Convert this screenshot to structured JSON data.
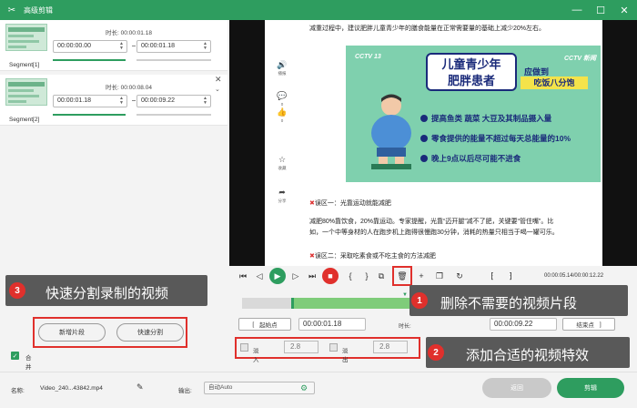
{
  "window": {
    "title": "高级剪辑"
  },
  "segments": [
    {
      "name": "Segment[1]",
      "duration_label": "时长:",
      "duration": "00:00:01.18",
      "start": "00:00:00.00",
      "end": "00:00:01.18"
    },
    {
      "name": "Segment[2]",
      "duration_label": "时长:",
      "duration": "00:00:08.04",
      "start": "00:00:01.18",
      "end": "00:00:09.22"
    }
  ],
  "annotations": {
    "n1": "1",
    "t1": "删除不需要的视频片段",
    "n2": "2",
    "t2": "添加合适的视频特效",
    "n3": "3",
    "t3": "快速分割录制的视频"
  },
  "left_buttons": {
    "new_segment": "新增片段",
    "quick_split": "快速分割"
  },
  "merge_all": "合并所有",
  "preview": {
    "text_top": "减重过程中，建议肥胖儿童青少年的膳食能量在正常需要量的基础上减少20%左右。",
    "banner": {
      "brand_left": "CCTV 13",
      "brand_right": "CCTV 新闻",
      "headline1": "儿童青少年",
      "headline2": "肥胖患者",
      "should": "应做到",
      "eat": "吃饭八分饱",
      "b1": "提高鱼类  蔬菜  大豆及其制品摄入量",
      "b2": "零食提供的能量不超过每天总能量的10%",
      "b3": "晚上9点以后尽可能不进食"
    },
    "mis1_title": "误区一：光靠运动就能减肥",
    "mis1_text1": "减肥80%靠饮食，20%靠运动。专家提醒，光靠“迈开腿”减不了肥，关键要“管住嘴”。比",
    "mis1_text2": "如，一个中等身材的人在跑步机上跑得很慢跑30分钟，消耗的热量只相当于喝一罐可乐。",
    "mis2_title": "误区二：采取吃素食或不吃主食的方法减肥",
    "side": {
      "like": "播报",
      "comment": "0",
      "thumb": "0",
      "fav": "收藏",
      "share": "分享"
    }
  },
  "timecode": "00:00:05.14/00:00:12.22",
  "trim": {
    "start_btn": "起始点",
    "start": "00:00:01.18",
    "duration_label": "时长:",
    "end": "00:00:09.22",
    "end_btn": "结束点"
  },
  "effects": {
    "fadein_label": "淡入",
    "fadein": "2.8",
    "fadeout_label": "淡出",
    "fadeout": "2.8"
  },
  "footer": {
    "name_label": "名称:",
    "name": "Video_240...43842.mp4",
    "output_label": "输出:",
    "output": "自动Auto",
    "back": "返回",
    "cut": "剪辑"
  }
}
